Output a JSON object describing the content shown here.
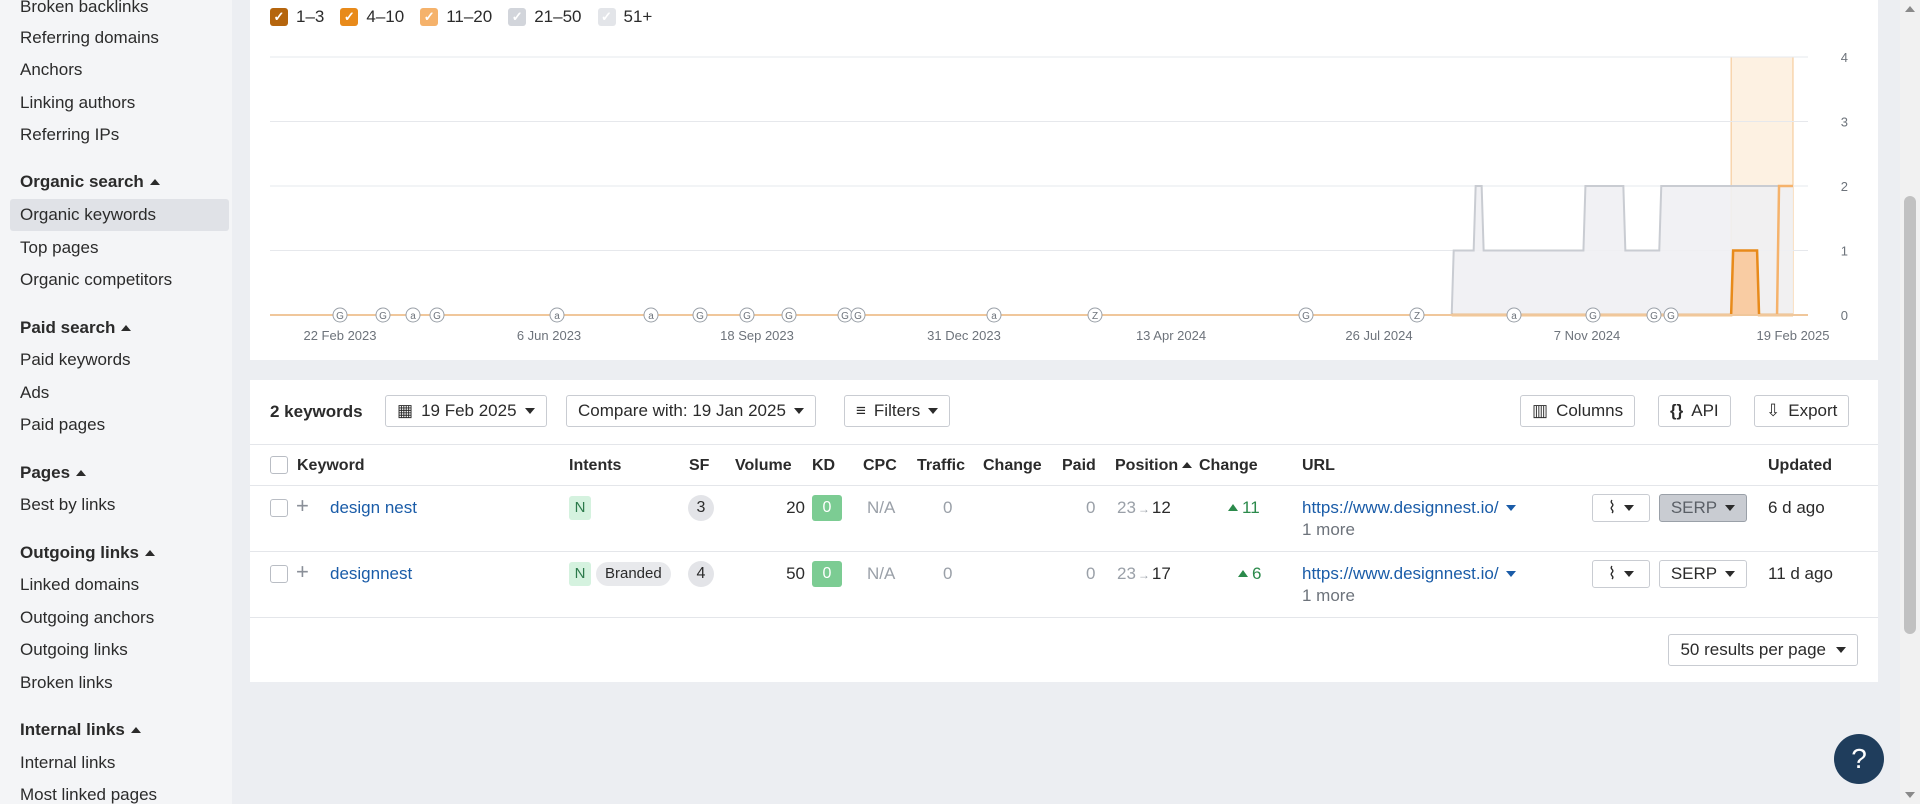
{
  "sidebar": {
    "items": [
      {
        "label": "Broken backlinks"
      },
      {
        "label": "Referring domains"
      },
      {
        "label": "Anchors"
      },
      {
        "label": "Linking authors"
      },
      {
        "label": "Referring IPs"
      }
    ],
    "organic_search": {
      "heading": "Organic search",
      "items": [
        {
          "label": "Organic keywords",
          "active": true
        },
        {
          "label": "Top pages"
        },
        {
          "label": "Organic competitors"
        }
      ]
    },
    "paid_search": {
      "heading": "Paid search",
      "items": [
        {
          "label": "Paid keywords"
        },
        {
          "label": "Ads"
        },
        {
          "label": "Paid pages"
        }
      ]
    },
    "pages": {
      "heading": "Pages",
      "items": [
        {
          "label": "Best by links"
        }
      ]
    },
    "outgoing_links": {
      "heading": "Outgoing links",
      "items": [
        {
          "label": "Linked domains"
        },
        {
          "label": "Outgoing anchors"
        },
        {
          "label": "Outgoing links"
        },
        {
          "label": "Broken links"
        }
      ]
    },
    "internal_links": {
      "heading": "Internal links",
      "items": [
        {
          "label": "Internal links"
        },
        {
          "label": "Most linked pages"
        }
      ]
    }
  },
  "legend": [
    {
      "label": "1–3",
      "checked": true,
      "color": "#b5650d"
    },
    {
      "label": "4–10",
      "checked": true,
      "color": "#e88a1a"
    },
    {
      "label": "11–20",
      "checked": true,
      "color": "#f5b26b"
    },
    {
      "label": "21–50",
      "checked": true,
      "color": "#d2d5db"
    },
    {
      "label": "51+",
      "checked": true,
      "color": "#e3e5e9"
    }
  ],
  "chart_data": {
    "type": "area",
    "x_ticks": [
      "22 Feb 2023",
      "6 Jun 2023",
      "18 Sep 2023",
      "31 Dec 2023",
      "13 Apr 2024",
      "26 Jul 2024",
      "7 Nov 2024",
      "19 Feb 2025"
    ],
    "y_ticks": [
      "0",
      "1",
      "2",
      "3",
      "4"
    ],
    "ylim": [
      0,
      4
    ],
    "y_axis_side": "right",
    "grid": true,
    "series": [
      {
        "name": "21–50",
        "color": "#c9ccd2",
        "points": [
          [
            "2024-09-01",
            0
          ],
          [
            "2024-09-02",
            1
          ],
          [
            "2024-09-12",
            1
          ],
          [
            "2024-09-13",
            2
          ],
          [
            "2024-09-16",
            2
          ],
          [
            "2024-09-17",
            1
          ],
          [
            "2024-11-06",
            1
          ],
          [
            "2024-11-07",
            2
          ],
          [
            "2024-11-26",
            2
          ],
          [
            "2024-11-27",
            1
          ],
          [
            "2024-12-14",
            1
          ],
          [
            "2024-12-15",
            2
          ],
          [
            "2025-02-11",
            2
          ],
          [
            "2025-02-12",
            2
          ],
          [
            "2025-02-19",
            2
          ]
        ]
      },
      {
        "name": "4–10",
        "color": "#e88a1a",
        "points": [
          [
            "2024-09-01",
            0
          ],
          [
            "2025-01-19",
            0
          ],
          [
            "2025-01-20",
            1
          ],
          [
            "2025-02-01",
            1
          ],
          [
            "2025-02-02",
            0
          ],
          [
            "2025-02-19",
            0
          ]
        ]
      },
      {
        "name": "11–20",
        "color": "#f5b26b",
        "points": [
          [
            "2025-02-11",
            0
          ],
          [
            "2025-02-12",
            2
          ],
          [
            "2025-02-19",
            2
          ]
        ]
      }
    ],
    "highlight_range": [
      "2025-01-19",
      "2025-02-19"
    ],
    "annotations_row": [
      "G",
      "G",
      "a",
      "G",
      "a",
      "a",
      "G",
      "G",
      "G",
      "G",
      "G",
      "a",
      "Z",
      "G",
      "Z",
      "a",
      "G",
      "G",
      "G"
    ]
  },
  "toolbar": {
    "keyword_count": "2 keywords",
    "date": "19 Feb 2025",
    "compare": "Compare with: 19 Jan 2025",
    "filters": "Filters",
    "columns": "Columns",
    "api": "API",
    "export": "Export"
  },
  "table": {
    "headers": {
      "keyword": "Keyword",
      "intents": "Intents",
      "sf": "SF",
      "volume": "Volume",
      "kd": "KD",
      "cpc": "CPC",
      "traffic": "Traffic",
      "change": "Change",
      "paid": "Paid",
      "position": "Position",
      "change2": "Change",
      "url": "URL",
      "updated": "Updated"
    },
    "rows": [
      {
        "keyword": "design nest",
        "intent": "N",
        "branded": "",
        "sf": "3",
        "volume": "20",
        "kd": "0",
        "cpc": "N/A",
        "traffic": "0",
        "paid": "0",
        "pos_from": "23",
        "pos_to": "12",
        "change": "11",
        "url": "https://www.designnest.io/",
        "more": "1 more",
        "serp": "SERP",
        "updated": "6 d ago"
      },
      {
        "keyword": "designnest",
        "intent": "N",
        "branded": "Branded",
        "sf": "4",
        "volume": "50",
        "kd": "0",
        "cpc": "N/A",
        "traffic": "0",
        "paid": "0",
        "pos_from": "23",
        "pos_to": "17",
        "change": "6",
        "url": "https://www.designnest.io/",
        "more": "1 more",
        "serp": "SERP",
        "updated": "11 d ago"
      }
    ]
  },
  "pagination": {
    "per_page": "50 results per page"
  },
  "help": {
    "label": "?"
  }
}
